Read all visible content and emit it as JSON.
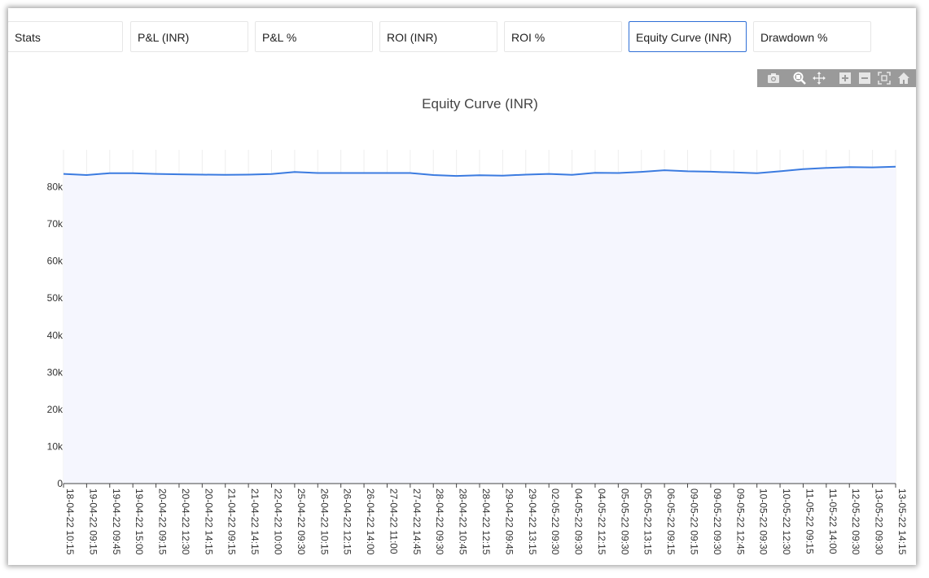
{
  "tabs": [
    {
      "label": "Stats"
    },
    {
      "label": "P&L (INR)"
    },
    {
      "label": "P&L %"
    },
    {
      "label": "ROI (INR)"
    },
    {
      "label": "ROI %"
    },
    {
      "label": "Equity Curve (INR)",
      "active": true
    },
    {
      "label": "Drawdown %"
    }
  ],
  "modebar": {
    "icons": [
      "camera-icon",
      "zoom-icon",
      "pan-icon",
      "zoom-in-icon",
      "zoom-out-icon",
      "autoscale-icon",
      "home-icon"
    ]
  },
  "colors": {
    "line": "#3b7be0",
    "fill": "#f5f6fe",
    "active_tab_border": "#2f6fd6",
    "modebar_bg": "#9a9a9a"
  },
  "chart_data": {
    "type": "area",
    "title": "Equity Curve (INR)",
    "xlabel": "",
    "ylabel": "",
    "ylim": [
      0,
      90000
    ],
    "yticks": [
      0,
      10000,
      20000,
      30000,
      40000,
      50000,
      60000,
      70000,
      80000
    ],
    "ytick_labels": [
      "0",
      "10k",
      "20k",
      "30k",
      "40k",
      "50k",
      "60k",
      "70k",
      "80k"
    ],
    "grid": "vertical",
    "x": [
      "18-04-22 10:15",
      "19-04-22 09:15",
      "19-04-22 09:45",
      "19-04-22 15:00",
      "20-04-22 09:15",
      "20-04-22 12:30",
      "20-04-22 14:15",
      "21-04-22 09:15",
      "21-04-22 14:15",
      "22-04-22 10:00",
      "25-04-22 09:30",
      "26-04-22 10:15",
      "26-04-22 12:15",
      "26-04-22 14:00",
      "27-04-22 11:00",
      "27-04-22 14:45",
      "28-04-22 09:30",
      "28-04-22 10:45",
      "28-04-22 12:15",
      "29-04-22 09:45",
      "29-04-22 13:15",
      "02-05-22 09:30",
      "04-05-22 09:30",
      "04-05-22 12:15",
      "05-05-22 09:30",
      "05-05-22 13:15",
      "06-05-22 09:15",
      "09-05-22 09:15",
      "09-05-22 09:30",
      "09-05-22 12:45",
      "10-05-22 09:30",
      "10-05-22 12:30",
      "11-05-22 09:15",
      "11-05-22 14:00",
      "12-05-22 09:30",
      "13-05-22 09:30",
      "13-05-22 14:15"
    ],
    "series": [
      {
        "values": [
          83500,
          83200,
          83700,
          83700,
          83500,
          83400,
          83300,
          83250,
          83300,
          83450,
          84000,
          83750,
          83750,
          83750,
          83750,
          83750,
          83200,
          82950,
          83150,
          83050,
          83300,
          83500,
          83250,
          83800,
          83750,
          84050,
          84500,
          84200,
          84100,
          83900,
          83700,
          84200,
          84800,
          85100,
          85350,
          85250,
          85450
        ]
      }
    ]
  }
}
